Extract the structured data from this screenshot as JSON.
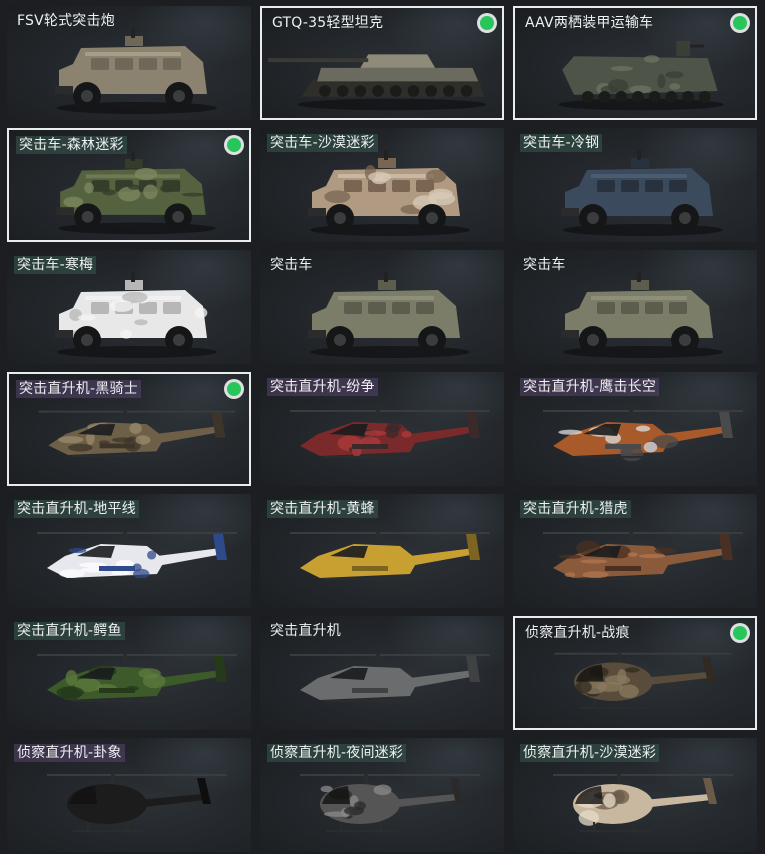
{
  "colors": {
    "selected_border": "#e9ecef",
    "equipped_dot": "#26c65a"
  },
  "vehicles": [
    {
      "label": "FSV轮式突击炮",
      "kind": "car",
      "variant": "plain",
      "tag": "plain",
      "selected": false,
      "equipped": false,
      "palette": [
        "#8c8270",
        "#6f6757",
        "#b8ad98"
      ]
    },
    {
      "label": "GTQ-35轻型坦克",
      "kind": "tank",
      "variant": "plain",
      "tag": "plain",
      "selected": true,
      "equipped": true,
      "palette": [
        "#6b6a5e",
        "#4d4c43",
        "#8e8b7b"
      ]
    },
    {
      "label": "AAV两栖装甲运输车",
      "kind": "amph",
      "variant": "plain",
      "tag": "plain",
      "selected": true,
      "equipped": true,
      "palette": [
        "#4e5447",
        "#3a3f35",
        "#6d7462"
      ]
    },
    {
      "label": "突击车-森林迷彩",
      "kind": "car",
      "variant": "camo",
      "tag": "green",
      "selected": true,
      "equipped": true,
      "palette": [
        "#55623f",
        "#343c2a",
        "#7f8a62"
      ]
    },
    {
      "label": "突击车-沙漠迷彩",
      "kind": "car",
      "variant": "camo",
      "tag": "green",
      "selected": false,
      "equipped": false,
      "palette": [
        "#b09a82",
        "#7a6452",
        "#d8cbb8"
      ]
    },
    {
      "label": "突击车-冷钢",
      "kind": "car",
      "variant": "plain",
      "tag": "green",
      "selected": false,
      "equipped": false,
      "palette": [
        "#3b4a5c",
        "#28323f",
        "#56697f"
      ]
    },
    {
      "label": "突击车-寒梅",
      "kind": "car",
      "variant": "camo",
      "tag": "green",
      "selected": false,
      "equipped": false,
      "palette": [
        "#e8e8e8",
        "#b7b7b7",
        "#f6f6f6"
      ]
    },
    {
      "label": "突击车",
      "kind": "car",
      "variant": "plain",
      "tag": "plain",
      "selected": false,
      "equipped": false,
      "palette": [
        "#7c7d68",
        "#5c5d4d",
        "#9a9b84"
      ]
    },
    {
      "label": "突击车",
      "kind": "car",
      "variant": "plain",
      "tag": "plain",
      "selected": false,
      "equipped": false,
      "palette": [
        "#7c7d68",
        "#5c5d4d",
        "#9a9b84"
      ]
    },
    {
      "label": "突击直升机-黑骑士",
      "kind": "heli",
      "variant": "camo",
      "tag": "purple",
      "selected": true,
      "equipped": true,
      "palette": [
        "#6e5f48",
        "#3e352a",
        "#9b8a6c"
      ]
    },
    {
      "label": "突击直升机-纷争",
      "kind": "heli",
      "variant": "camo",
      "tag": "purple",
      "selected": false,
      "equipped": false,
      "palette": [
        "#7a2a2a",
        "#3a2a2a",
        "#b03a3a"
      ]
    },
    {
      "label": "突击直升机-鹰击长空",
      "kind": "heli",
      "variant": "camo",
      "tag": "purple",
      "selected": false,
      "equipped": false,
      "palette": [
        "#a85a2a",
        "#4a4a4a",
        "#dedede"
      ]
    },
    {
      "label": "突击直升机-地平线",
      "kind": "heli",
      "variant": "camo",
      "tag": "green",
      "selected": false,
      "equipped": false,
      "palette": [
        "#e6e8ee",
        "#2f4a8a",
        "#ffffff"
      ]
    },
    {
      "label": "突击直升机-黄蜂",
      "kind": "heli",
      "variant": "plain",
      "tag": "green",
      "selected": false,
      "equipped": false,
      "palette": [
        "#c8a032",
        "#7d6420",
        "#e0c050"
      ]
    },
    {
      "label": "突击直升机-猎虎",
      "kind": "heli",
      "variant": "camo",
      "tag": "green",
      "selected": false,
      "equipped": false,
      "palette": [
        "#8a5a3a",
        "#4a3022",
        "#b07850"
      ]
    },
    {
      "label": "突击直升机-鳄鱼",
      "kind": "heli",
      "variant": "camo",
      "tag": "green",
      "selected": false,
      "equipped": false,
      "palette": [
        "#3d5a2a",
        "#263a1a",
        "#5e7c3e"
      ]
    },
    {
      "label": "突击直升机",
      "kind": "heli",
      "variant": "plain",
      "tag": "plain",
      "selected": false,
      "equipped": false,
      "palette": [
        "#6a6c6e",
        "#3f4143",
        "#8c8e90"
      ]
    },
    {
      "label": "侦察直升机-战痕",
      "kind": "scout",
      "variant": "camo",
      "tag": "plain",
      "selected": true,
      "equipped": true,
      "palette": [
        "#5a4c3a",
        "#322a20",
        "#8a7a60"
      ]
    },
    {
      "label": "侦察直升机-卦象",
      "kind": "scout",
      "variant": "plain",
      "tag": "purple",
      "selected": false,
      "equipped": false,
      "palette": [
        "#1c1c1c",
        "#0e0e0e",
        "#dcdcdc"
      ]
    },
    {
      "label": "侦察直升机-夜间迷彩",
      "kind": "scout",
      "variant": "camo",
      "tag": "green",
      "selected": false,
      "equipped": false,
      "palette": [
        "#555555",
        "#2a2a2a",
        "#8a8a8a"
      ]
    },
    {
      "label": "侦察直升机-沙漠迷彩",
      "kind": "scout",
      "variant": "camo",
      "tag": "green",
      "selected": false,
      "equipped": false,
      "palette": [
        "#c8b8a0",
        "#6a5a48",
        "#e8dcc8"
      ]
    }
  ]
}
